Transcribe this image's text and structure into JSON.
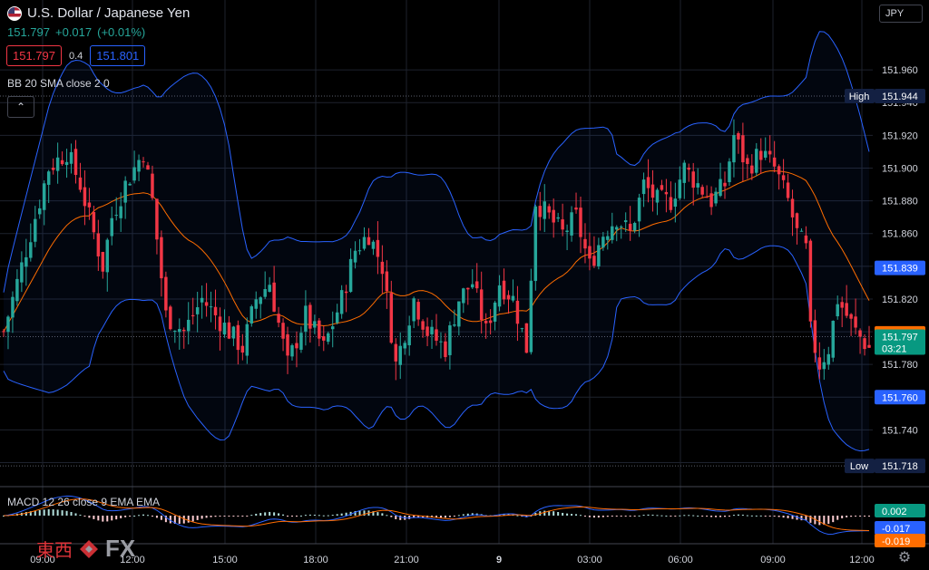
{
  "header": {
    "title": "U.S. Dollar / Japanese Yen",
    "price": "151.797",
    "change": "+0.017",
    "change_pct": "(+0.01%)",
    "bid": "151.797",
    "spread": "0.4",
    "ask": "151.801",
    "currency": "JPY"
  },
  "indicators": {
    "bb_label": "BB 20 SMA close 2 0",
    "macd_label": "MACD 12 26 close 9 EMA EMA"
  },
  "watermark": {
    "cn": "東西",
    "fx": "FX"
  },
  "colors": {
    "bg": "#000000",
    "up": "#26a69a",
    "down": "#f23645",
    "bb_band": "#2962ff",
    "bb_basis": "#ff6d00",
    "grid": "#1e222d",
    "label_blue": "#2962ff",
    "label_orange": "#ff6d00",
    "label_green": "#089981",
    "label_navy": "#132042"
  },
  "chart_data": {
    "type": "candlestick",
    "symbol": "USDJPY",
    "y_ticks": [
      "151.960",
      "151.940",
      "151.920",
      "151.900",
      "151.880",
      "151.860",
      "151.840",
      "151.820",
      "151.800",
      "151.780",
      "151.760",
      "151.740",
      "151.720"
    ],
    "ylim": [
      151.712,
      151.975
    ],
    "x_ticks": [
      "09:00",
      "12:00",
      "15:00",
      "18:00",
      "21:00",
      "9",
      "03:00",
      "06:00",
      "09:00",
      "12:00"
    ],
    "high": {
      "label": "High",
      "value": "151.944"
    },
    "low": {
      "label": "Low",
      "value": "151.718"
    },
    "bb_upper_last": "151.839",
    "bb_basis_last": "151.799",
    "bb_lower_last": "151.760",
    "last_price": "151.797",
    "countdown": "03:21",
    "close_path": [
      [
        0,
        151.8
      ],
      [
        3,
        151.83
      ],
      [
        7,
        151.87
      ],
      [
        10,
        151.9
      ],
      [
        14,
        151.91
      ],
      [
        17,
        151.89
      ],
      [
        20,
        151.86
      ],
      [
        22,
        151.84
      ],
      [
        24,
        151.87
      ],
      [
        27,
        151.89
      ],
      [
        31,
        151.91
      ],
      [
        33,
        151.88
      ],
      [
        36,
        151.81
      ],
      [
        40,
        151.8
      ],
      [
        44,
        151.82
      ],
      [
        47,
        151.81
      ],
      [
        50,
        151.8
      ],
      [
        53,
        151.79
      ],
      [
        56,
        151.82
      ],
      [
        59,
        151.83
      ],
      [
        63,
        151.78
      ],
      [
        67,
        151.81
      ],
      [
        71,
        151.79
      ],
      [
        75,
        151.82
      ],
      [
        78,
        151.85
      ],
      [
        81,
        151.86
      ],
      [
        84,
        151.84
      ],
      [
        87,
        151.78
      ],
      [
        89,
        151.8
      ],
      [
        91,
        151.82
      ],
      [
        94,
        151.8
      ],
      [
        98,
        151.79
      ],
      [
        101,
        151.82
      ],
      [
        104,
        151.83
      ],
      [
        107,
        151.8
      ],
      [
        110,
        151.83
      ],
      [
        113,
        151.82
      ],
      [
        116,
        151.79
      ],
      [
        118,
        151.88
      ],
      [
        121,
        151.87
      ],
      [
        124,
        151.86
      ],
      [
        127,
        151.87
      ],
      [
        130,
        151.84
      ],
      [
        133,
        151.86
      ],
      [
        136,
        151.87
      ],
      [
        139,
        151.86
      ],
      [
        142,
        151.89
      ],
      [
        145,
        151.88
      ],
      [
        148,
        151.88
      ],
      [
        151,
        151.9
      ],
      [
        154,
        151.89
      ],
      [
        157,
        151.88
      ],
      [
        160,
        151.89
      ],
      [
        162,
        151.92
      ],
      [
        165,
        151.9
      ],
      [
        168,
        151.91
      ],
      [
        171,
        151.9
      ],
      [
        174,
        151.88
      ],
      [
        176,
        151.86
      ],
      [
        178,
        151.85
      ],
      [
        179,
        151.8
      ],
      [
        181,
        151.78
      ],
      [
        183,
        151.79
      ],
      [
        185,
        151.82
      ],
      [
        187,
        151.81
      ],
      [
        189,
        151.8
      ],
      [
        192,
        151.79
      ]
    ],
    "macd": {
      "labels": [
        "0.002",
        "-0.017",
        "-0.019"
      ],
      "label_colors": [
        "#089981",
        "#2962ff",
        "#ff6d00"
      ],
      "ylim": [
        -0.03,
        0.03
      ]
    }
  }
}
